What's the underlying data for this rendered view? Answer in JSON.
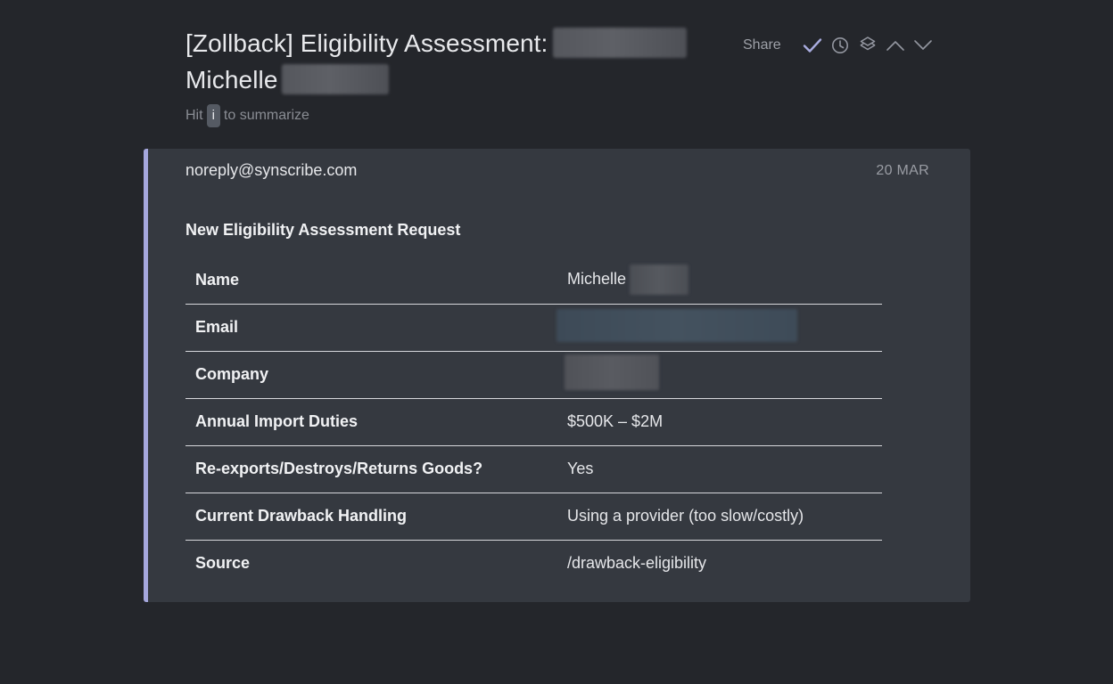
{
  "header": {
    "subject": "[Zollback] Eligibility Assessment:",
    "subject_name": "Michelle",
    "hint_prefix": "Hit",
    "hint_key": "i",
    "hint_suffix": "to summarize"
  },
  "toolbar": {
    "share_label": "Share",
    "icons": [
      "check-icon",
      "clock-icon",
      "layers-icon",
      "chevron-up-icon",
      "chevron-down-icon"
    ]
  },
  "email": {
    "sender": "noreply@synscribe.com",
    "date": "20 MAR",
    "heading": "New Eligibility Assessment Request",
    "rows": [
      {
        "label": "Name",
        "value": "Michelle"
      },
      {
        "label": "Email",
        "value": ""
      },
      {
        "label": "Company",
        "value": ""
      },
      {
        "label": "Annual Import Duties",
        "value": "$500K – $2M"
      },
      {
        "label": "Re-exports/Destroys/Returns Goods?",
        "value": "Yes"
      },
      {
        "label": "Current Drawback Handling",
        "value": "Using a provider (too slow/costly)"
      },
      {
        "label": "Source",
        "value": "/drawback-eligibility"
      }
    ]
  },
  "colors": {
    "background": "#24262b",
    "card": "#353940",
    "accent_border": "#a5a7dd",
    "check_icon": "#a9acdf"
  }
}
